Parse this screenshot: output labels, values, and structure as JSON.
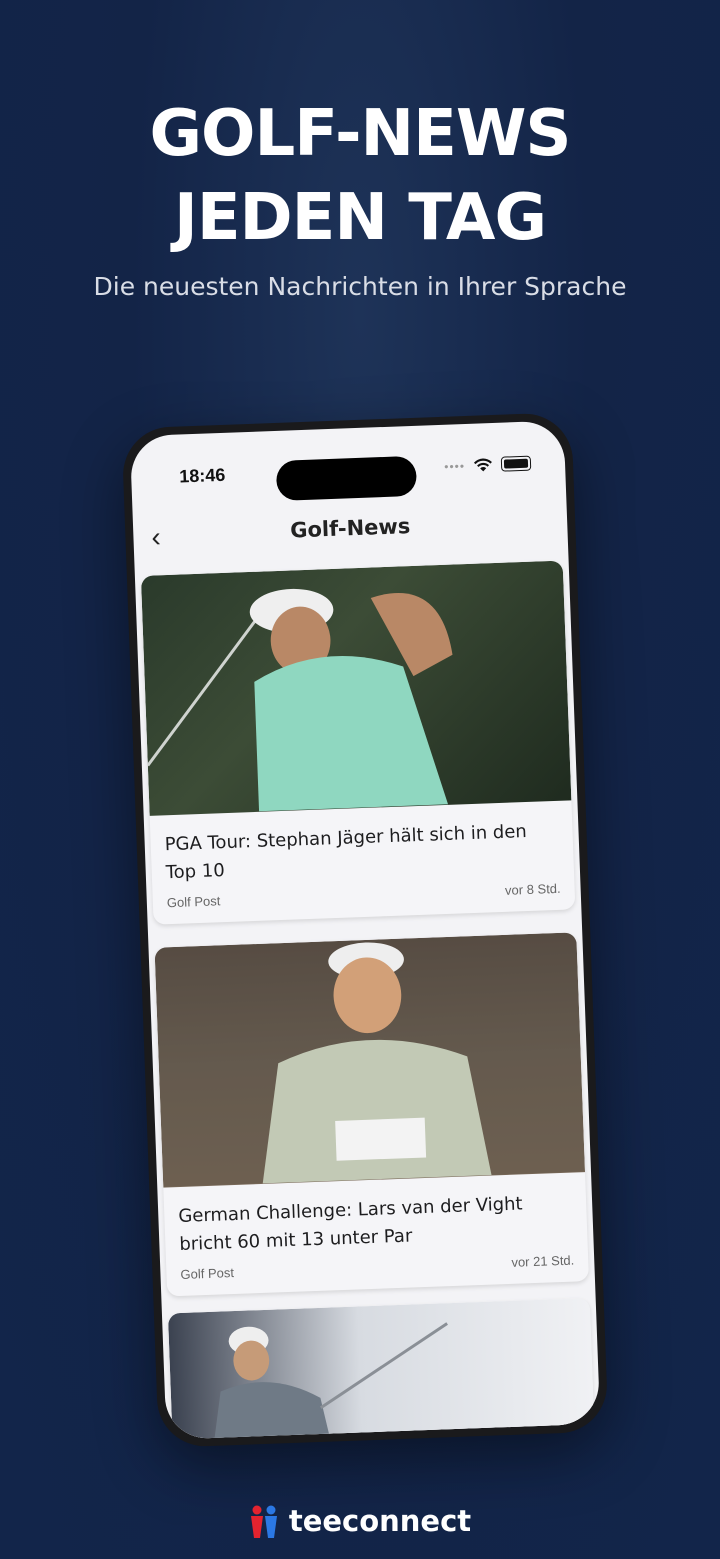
{
  "hero": {
    "headline_line1": "GOLF-NEWS",
    "headline_line2": "JEDEN TAG",
    "subline": "Die neuesten Nachrichten in Ihrer Sprache"
  },
  "phone": {
    "status_time": "18:46",
    "nav_title": "Golf-News",
    "back_icon": "chevron-left-icon"
  },
  "articles": [
    {
      "title": "PGA Tour: Stephan Jäger hält sich in den Top 10",
      "source": "Golf Post",
      "age": "vor 8 Std."
    },
    {
      "title": "German Challenge: Lars van der Vight bricht 60 mit 13 unter Par",
      "source": "Golf Post",
      "age": "vor 21 Std."
    }
  ],
  "brand": {
    "name": "teeconnect",
    "accent_red": "#e3232f",
    "accent_blue": "#2b78e4"
  },
  "colors": {
    "background": "#132447",
    "screen": "#f3f3f6"
  }
}
